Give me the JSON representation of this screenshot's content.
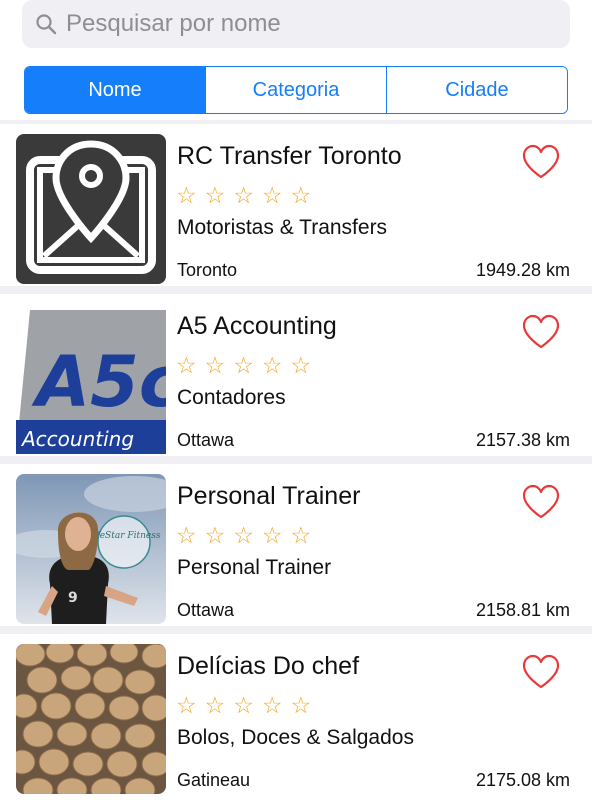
{
  "search": {
    "placeholder": "Pesquisar por nome"
  },
  "segments": [
    {
      "label": "Nome",
      "selected": true
    },
    {
      "label": "Categoria",
      "selected": false
    },
    {
      "label": "Cidade",
      "selected": false
    }
  ],
  "colors": {
    "accent": "#157efb",
    "star": "#f5a623",
    "heart": "#e8393a"
  },
  "listings": [
    {
      "title": "RC Transfer Toronto",
      "rating_stars": 0,
      "rating_max": 5,
      "category": "Motoristas & Transfers",
      "city": "Toronto",
      "distance": "1949.28 km",
      "thumbnail_icon": "map-pin-icon"
    },
    {
      "title": "A5 Accounting",
      "rating_stars": 0,
      "rating_max": 5,
      "category": "Contadores",
      "city": "Ottawa",
      "distance": "2157.38 km",
      "thumbnail_text": "A5c",
      "thumbnail_caption": "Accounting"
    },
    {
      "title": "Personal Trainer",
      "rating_stars": 0,
      "rating_max": 5,
      "category": "Personal Trainer",
      "city": "Ottawa",
      "distance": "2158.81 km",
      "thumbnail_text": "LifeStar Fitness"
    },
    {
      "title": "Delícias Do chef",
      "rating_stars": 0,
      "rating_max": 5,
      "category": "Bolos, Doces & Salgados",
      "city": "Gatineau",
      "distance": "2175.08 km"
    }
  ]
}
